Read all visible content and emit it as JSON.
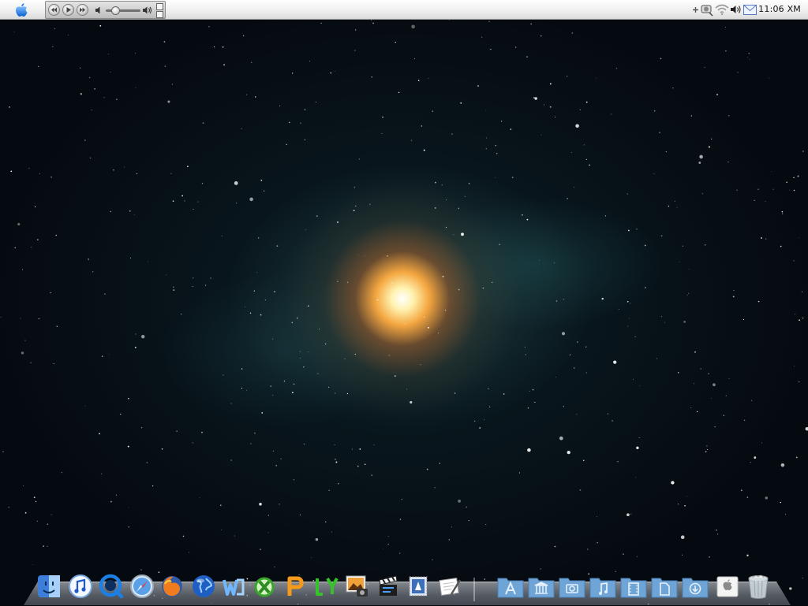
{
  "menubar": {
    "clock": "11:06 XM",
    "apple_menu": "apple-logo",
    "media_controls": [
      "previous-icon",
      "play-icon",
      "next-icon"
    ],
    "tray_icons": [
      "add-icon",
      "network-icon",
      "wifi-icon",
      "volume-icon",
      "mail-icon"
    ]
  },
  "dock": {
    "apps": [
      "finder-icon",
      "itunes-icon",
      "quicktime-icon",
      "safari-icon",
      "firefox-icon",
      "globe-icon",
      "word-icon",
      "excel-icon",
      "powerpoint-icon",
      "outlook-icon",
      "iphoto-icon",
      "imovie-icon",
      "mail-stamp-icon",
      "textedit-icon"
    ],
    "folders": [
      "applications-folder-icon",
      "library-folder-icon",
      "pictures-folder-icon",
      "music-folder-icon",
      "movies-folder-icon",
      "documents-folder-icon",
      "downloads-folder-icon"
    ],
    "extras": [
      "apple-box-icon",
      "trash-icon"
    ]
  },
  "colors": {
    "accent": "#1e7ee8",
    "desktop_bg": "#050a10",
    "galaxy_core": "#f4a640",
    "folder": "#6fa5d6"
  }
}
